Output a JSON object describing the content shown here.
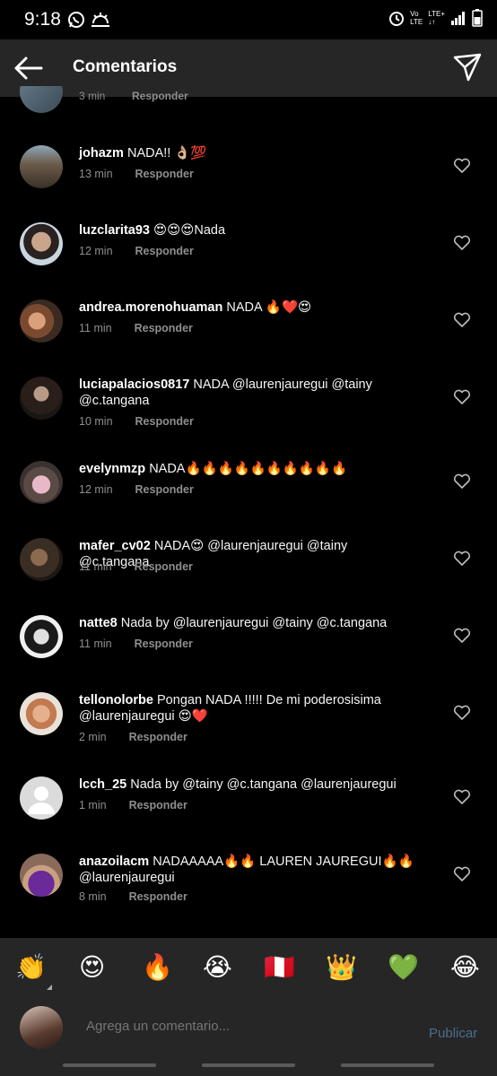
{
  "status_bar": {
    "time": "9:18",
    "icons": [
      "whatsapp-icon",
      "weather-icon",
      "alarm-icon",
      "volte-icon",
      "lte-icon",
      "signal-icon",
      "battery-icon"
    ],
    "lte_top": "Vo",
    "lte_bottom": "LTE",
    "lte_plus": "LTE+"
  },
  "header": {
    "title": "Comentarios"
  },
  "partial_comment": {
    "time": "3 min",
    "reply": "Responder"
  },
  "comments": [
    {
      "user": "johazm",
      "text": "NADA!! 👌🏼💯",
      "time": "13 min",
      "reply": "Responder"
    },
    {
      "user": "luzclarita93",
      "text": "😍😍😍Nada",
      "time": "12 min",
      "reply": "Responder"
    },
    {
      "user": "andrea.morenohuaman",
      "text": "NADA 🔥❤️😍",
      "time": "11 min",
      "reply": "Responder"
    },
    {
      "user": "luciapalacios0817",
      "text": "NADA @laurenjauregui  @tainy @c.tangana",
      "time": "10 min",
      "reply": "Responder"
    },
    {
      "user": "evelynmzp",
      "text": "NADA🔥🔥🔥🔥🔥🔥🔥🔥🔥🔥",
      "time": "12 min",
      "reply": "Responder"
    },
    {
      "user": "mafer_cv02",
      "text": "NADA😍 @laurenjauregui  @tainy @c.tangana",
      "time": "11 min",
      "reply": "Responder"
    },
    {
      "user": "natte8",
      "text": "Nada by @laurenjauregui @tainy  @c.tangana",
      "time": "11 min",
      "reply": "Responder"
    },
    {
      "user": "tellonolorbe",
      "text": "Pongan NADA !!!!! De mi poderosisima @laurenjauregui 😍❤️",
      "time": "2 min",
      "reply": "Responder"
    },
    {
      "user": "lcch_25",
      "text": "Nada by @tainy @c.tangana @laurenjauregui",
      "time": "1 min",
      "reply": "Responder"
    },
    {
      "user": "anazoilacm",
      "text": "NADAAAAA🔥🔥 LAUREN JAUREGUI🔥🔥 @laurenjauregui",
      "time": "8 min",
      "reply": "Responder"
    }
  ],
  "emoji_bar": [
    "👏",
    "😍",
    "🔥",
    "😭",
    "🇵🇪",
    "👑",
    "💚",
    "😂"
  ],
  "composer": {
    "placeholder": "Agrega un comentario...",
    "publish": "Publicar"
  },
  "colors": {
    "background": "#000000",
    "header": "#262626",
    "meta_text": "#8e8e8e",
    "publish_disabled": "#4a6d8c"
  }
}
